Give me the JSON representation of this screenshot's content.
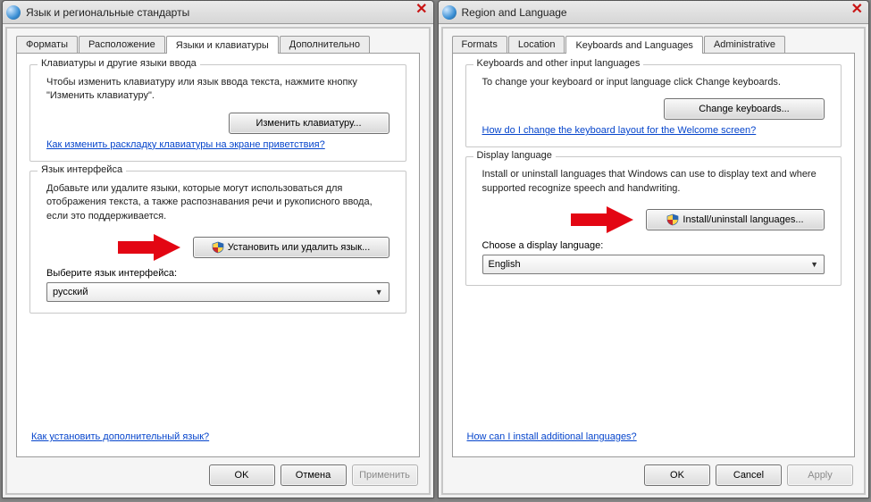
{
  "left": {
    "title": "Язык и региональные стандарты",
    "tabs": [
      "Форматы",
      "Расположение",
      "Языки и клавиатуры",
      "Дополнительно"
    ],
    "active_tab": 2,
    "group1": {
      "title": "Клавиатуры и другие языки ввода",
      "desc": "Чтобы изменить клавиатуру или язык ввода текста, нажмите кнопку \"Изменить клавиатуру\".",
      "btn": "Изменить клавиатуру...",
      "link": "Как изменить раскладку клавиатуры на экране приветствия?"
    },
    "group2": {
      "title": "Язык интерфейса",
      "desc": "Добавьте или удалите языки, которые могут использоваться для отображения текста, а также распознавания речи и рукописного ввода, если это поддерживается.",
      "btn": "Установить или удалить язык...",
      "choose": "Выберите язык интерфейса:",
      "value": "русский"
    },
    "bottom_link": "Как установить дополнительный язык?",
    "buttons": {
      "ok": "OK",
      "cancel": "Отмена",
      "apply": "Применить"
    }
  },
  "right": {
    "title": "Region and Language",
    "tabs": [
      "Formats",
      "Location",
      "Keyboards and Languages",
      "Administrative"
    ],
    "active_tab": 2,
    "group1": {
      "title": "Keyboards and other input languages",
      "desc": "To change your keyboard or input language click Change keyboards.",
      "btn": "Change keyboards...",
      "link": "How do I change the keyboard layout for the Welcome screen?"
    },
    "group2": {
      "title": "Display language",
      "desc": "Install or uninstall languages that Windows can use to display text and where supported recognize speech and handwriting.",
      "btn": "Install/uninstall languages...",
      "choose": "Choose a display language:",
      "value": "English"
    },
    "bottom_link": "How can I install additional languages?",
    "buttons": {
      "ok": "OK",
      "cancel": "Cancel",
      "apply": "Apply"
    }
  }
}
